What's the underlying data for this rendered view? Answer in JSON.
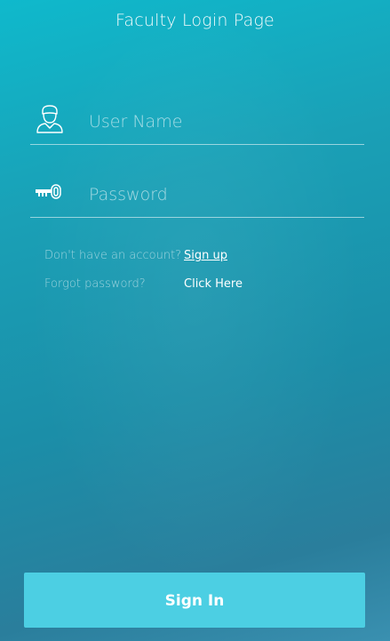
{
  "header": {
    "title": "Faculty Login Page"
  },
  "form": {
    "username": {
      "placeholder": "User Name",
      "value": "",
      "icon": "user-icon"
    },
    "password": {
      "placeholder": "Password",
      "value": "",
      "icon": "key-icon"
    }
  },
  "links": {
    "signup_prompt": "Don't have an account?",
    "signup_label": "Sign up",
    "forgot_prompt": "Forgot password?",
    "forgot_label": "Click Here"
  },
  "actions": {
    "signin_label": "Sign In"
  },
  "colors": {
    "button": "#4ccfe3",
    "underline": "#ffffff"
  }
}
